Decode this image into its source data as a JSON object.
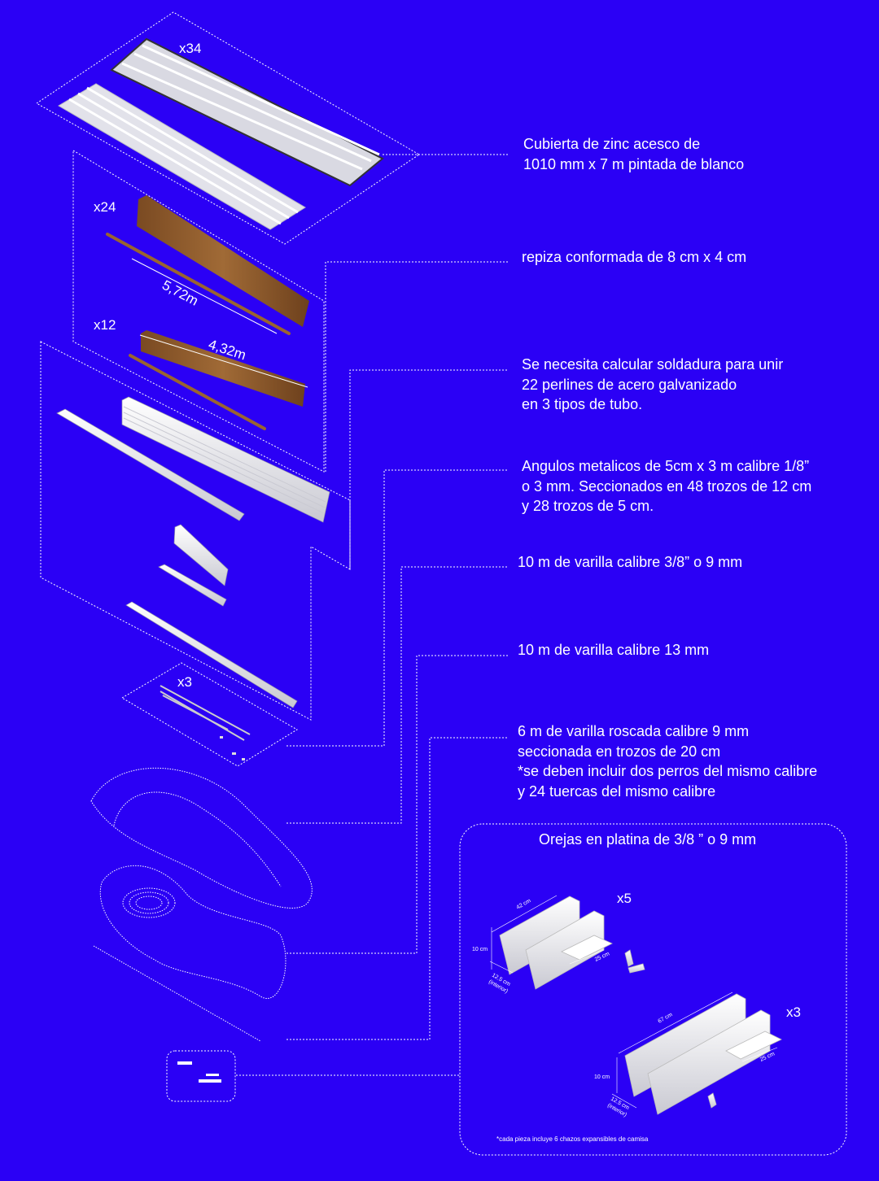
{
  "labels": {
    "zinc": "Cubierta de zinc acesco  de\n1010 mm x 7 m pintada de blanco",
    "repiza": "repiza conformada de 8 cm x 4 cm",
    "soldadura": "Se necesita calcular soldadura para unir\n22 perlines de acero galvanizado\nen 3 tipos de tubo.",
    "angulos": "Angulos metalicos de 5cm x 3 m  calibre 1/8”\no 3 mm. Seccionados en 48 trozos de 12 cm\ny 28 trozos de 5 cm.",
    "varilla_38": "10 m de varilla calibre 3/8” o 9 mm",
    "varilla_13": "10 m de varilla calibre 13 mm",
    "roscada": "6 m de varilla roscada calibre 9 mm\nseccionada en trozos de 20 cm\n*se deben incluir dos perros del mismo calibre\ny 24 tuercas del mismo calibre"
  },
  "counts": {
    "zinc": "x34",
    "wood_long": "x24",
    "wood_short": "x12",
    "angles": "x3",
    "ears_small": "x5",
    "ears_large": "x3"
  },
  "dimensions": {
    "wood_long": "5,72m",
    "wood_short": "4,32m"
  },
  "orejas": {
    "title": "Orejas en platina de 3/8 ” o 9 mm",
    "small": {
      "length": "42 cm",
      "height": "10 cm",
      "depth": "25 cm",
      "width": "12.5 cm",
      "width_note": "(interior)"
    },
    "large": {
      "length": "67 cm",
      "height": "10 cm",
      "depth": "25 cm",
      "width": "12.5 cm",
      "width_note": "(interior)"
    },
    "footnote": "*cada pieza incluye 6 chazos expansibles de camisa"
  },
  "colors": {
    "background": "#2B00F5",
    "lines": "#FFFFFF",
    "wood": "#8B5A2B",
    "metal": "#E8E8EE"
  }
}
